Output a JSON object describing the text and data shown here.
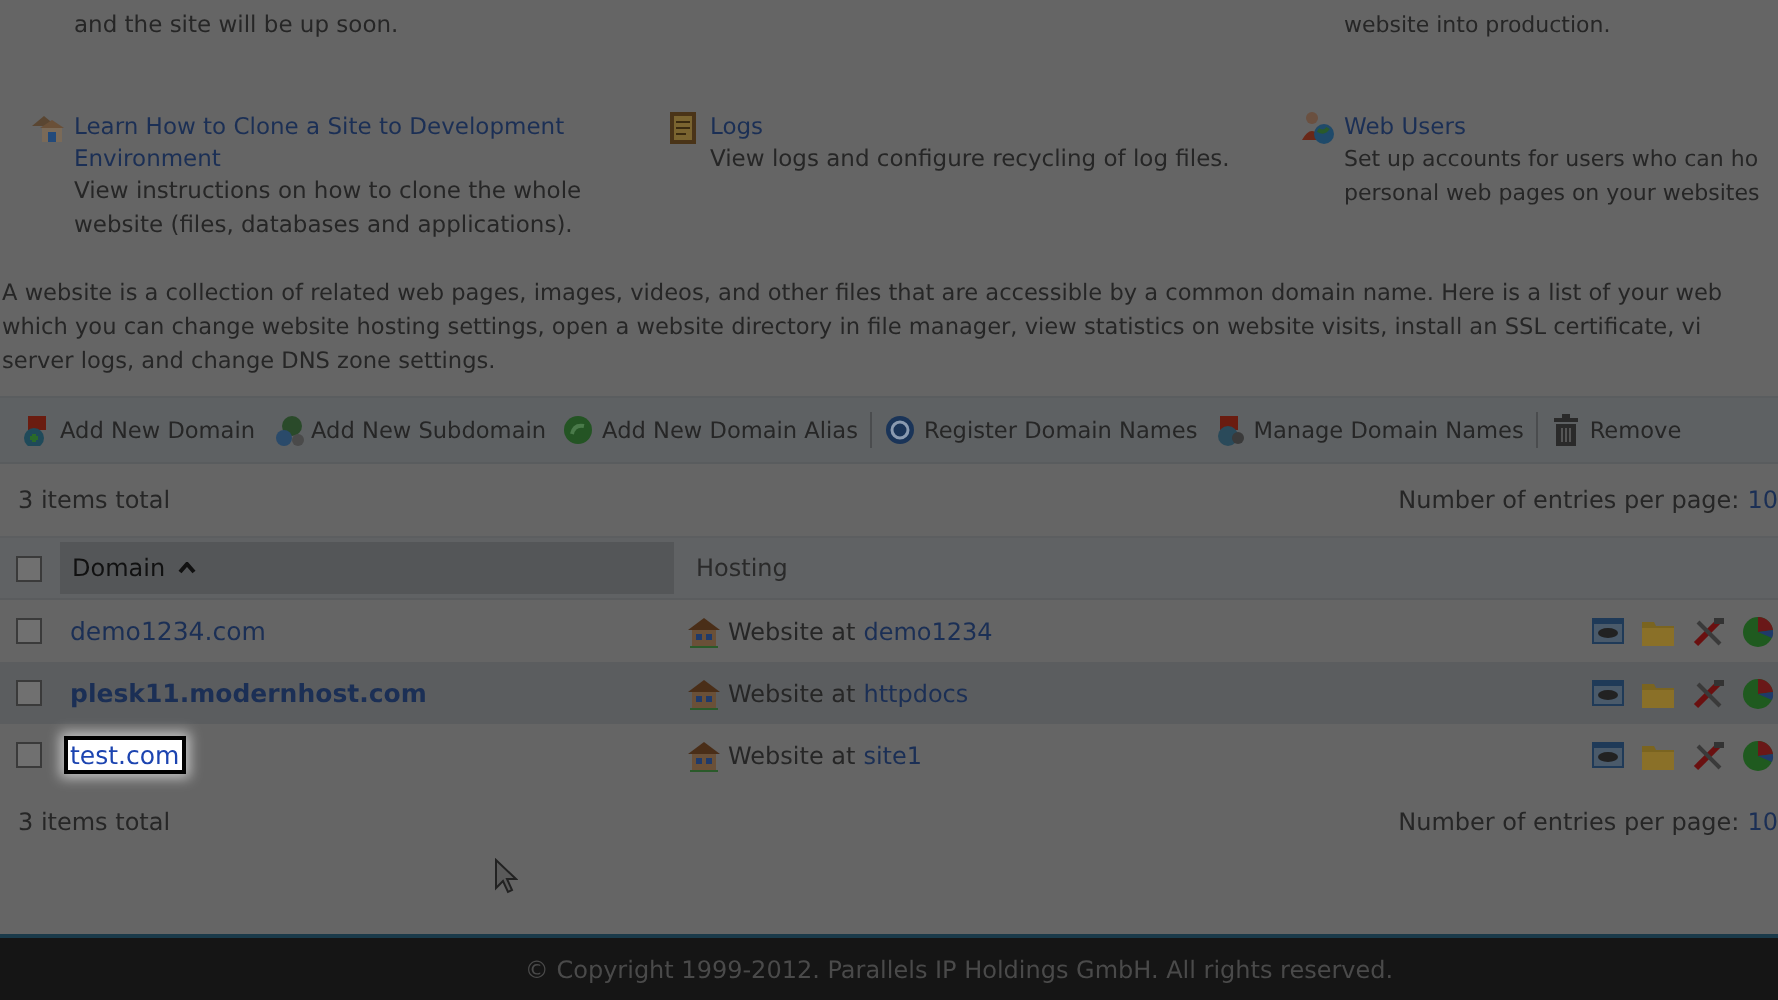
{
  "tools": [
    {
      "kind": "text",
      "text": "and the site will be up soon."
    },
    {
      "kind": "text"
    },
    {
      "kind": "text",
      "text": "website into production."
    },
    {
      "kind": "clone",
      "title": "Learn How to Clone a Site to Development Environment",
      "text": "View instructions on how to clone the whole website (files, databases and applications)."
    },
    {
      "kind": "logs",
      "title": "Logs",
      "text": "View logs and configure recycling of log files."
    },
    {
      "kind": "users",
      "title": "Web Users",
      "text": "Set up accounts for users who can ho\npersonal web pages on your websites"
    }
  ],
  "description": "A website is a collection of related web pages, images, videos, and other files that are accessible by a common domain name. Here is a list of your web\nwhich you can change website hosting settings, open a website directory in file manager, view statistics on website visits, install an SSL certificate, vi\nserver logs, and change DNS zone settings.",
  "toolbar": {
    "groups": [
      [
        {
          "kind": "domain",
          "label": "Add New Domain"
        },
        {
          "kind": "subdomain",
          "label": "Add New Subdomain"
        },
        {
          "kind": "alias",
          "label": "Add New Domain Alias"
        }
      ],
      [
        {
          "kind": "register",
          "label": "Register Domain Names"
        },
        {
          "kind": "manage",
          "label": "Manage Domain Names"
        }
      ],
      [
        {
          "kind": "remove",
          "label": "Remove"
        }
      ]
    ]
  },
  "pager_top": {
    "total": "3 items total",
    "entries_label": "Number of entries per page:",
    "entries_value": "10"
  },
  "table": {
    "select_all_checked": false,
    "columns": [
      {
        "label": "Domain",
        "sorted": true,
        "selected": true
      },
      {
        "label": "Hosting",
        "sorted": false,
        "selected": false
      }
    ],
    "rows": [
      {
        "domain": "demo1234.com",
        "hovered": false,
        "highlighted": false,
        "checked": false,
        "hosting_prefix": "Website at",
        "hosting_link": "demo1234"
      },
      {
        "domain": "plesk11.modernhost.com",
        "hovered": true,
        "highlighted": false,
        "checked": false,
        "hosting_prefix": "Website at",
        "hosting_link": "httpdocs"
      },
      {
        "domain": "test.com",
        "hovered": false,
        "highlighted": true,
        "checked": false,
        "hosting_prefix": "Website at",
        "hosting_link": "site1"
      }
    ]
  },
  "pager_bottom": {
    "total": "3 items total",
    "entries_label": "Number of entries per page:",
    "entries_value": "10"
  },
  "footer": {
    "copyright": "© Copyright 1999-2012. Parallels IP Holdings GmbH. All rights reserved."
  }
}
